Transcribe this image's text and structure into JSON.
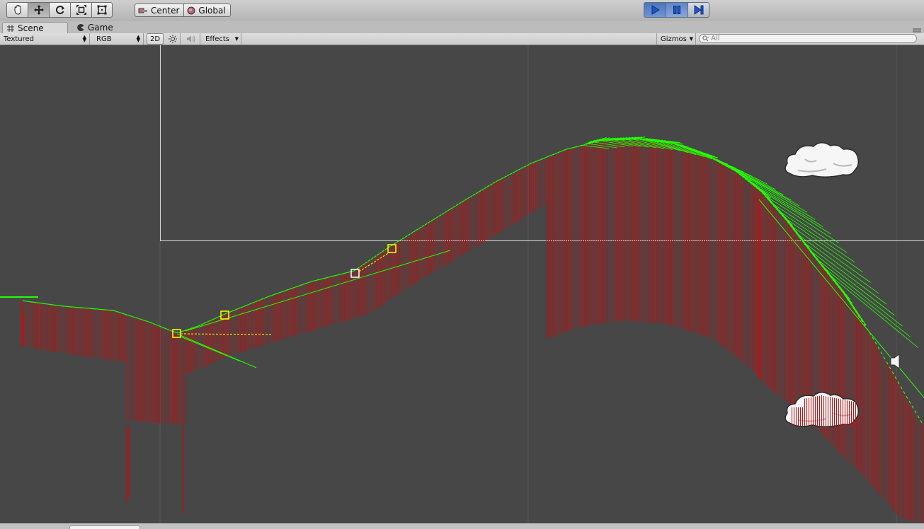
{
  "toolbar": {
    "tools": [
      {
        "name": "hand-tool",
        "icon": "hand-icon"
      },
      {
        "name": "move-tool",
        "icon": "move-arrows-icon"
      },
      {
        "name": "rotate-tool",
        "icon": "rotate-icon"
      },
      {
        "name": "scale-tool",
        "icon": "scale-icon"
      },
      {
        "name": "rect-tool",
        "icon": "rect-icon"
      }
    ],
    "pivot_mode": "Center",
    "pivot_rotation": "Global",
    "play_controls": {
      "play_icon": "play-icon",
      "pause_icon": "pause-icon",
      "step_icon": "step-icon",
      "active_color": "#3d6cc0"
    }
  },
  "tabs": {
    "scene": "Scene",
    "game": "Game",
    "menu_icon": "tab-menu-icon"
  },
  "scene_bar": {
    "draw_mode": "Textured",
    "render_mode": "RGB",
    "mode_2d": "2D",
    "lighting_icon": "sun-icon",
    "audio_icon": "speaker-icon",
    "effects": "Effects",
    "gizmos": "Gizmos",
    "search_placeholder": "All"
  },
  "viewport": {
    "background": "#474747",
    "terrain_color": "#c01010",
    "normals_color": "#22ff00",
    "selection_color": "#ffff00",
    "icons": [
      "cloud-sprite",
      "cloud-sprite",
      "audio-source-gizmo"
    ]
  }
}
